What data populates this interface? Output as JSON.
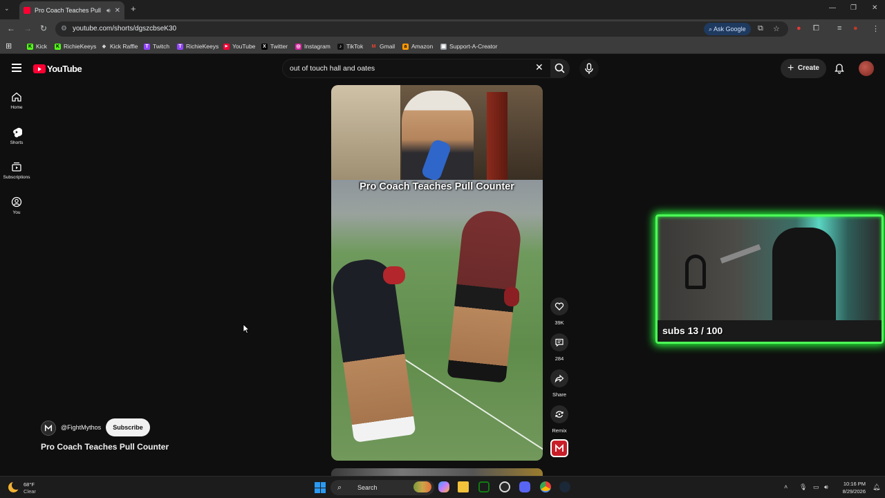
{
  "browser": {
    "tab_title": "Pro Coach Teaches Pull Counter",
    "url": "youtube.com/shorts/dgszcbseK30",
    "ask_google_label": "Ask Google",
    "bookmarks": [
      {
        "label": "Kick",
        "color": "#53fc18",
        "icon": "K"
      },
      {
        "label": "RichieKeeys",
        "color": "#53fc18",
        "icon": "K"
      },
      {
        "label": "Kick Raffle",
        "color": "#d0d0d0",
        "icon": "◆"
      },
      {
        "label": "Twitch",
        "color": "#9146ff",
        "icon": "T"
      },
      {
        "label": "RichieKeeys",
        "color": "#9146ff",
        "icon": "T"
      },
      {
        "label": "YouTube",
        "color": "#ff0033",
        "icon": "▶"
      },
      {
        "label": "Twitter",
        "color": "#000000",
        "icon": "X"
      },
      {
        "label": "Instagram",
        "color": "#d6249f",
        "icon": "◎"
      },
      {
        "label": "TikTok",
        "color": "#111111",
        "icon": "♪"
      },
      {
        "label": "Gmail",
        "color": "#ea4335",
        "icon": "M"
      },
      {
        "label": "Amazon",
        "color": "#ff9900",
        "icon": "a"
      },
      {
        "label": "Support-A-Creator",
        "color": "#9aa0a6",
        "icon": "▣"
      }
    ]
  },
  "youtube": {
    "logo_text": "YouTube",
    "search_query": "out of touch hall and oates",
    "create_label": "Create",
    "rail": [
      {
        "label": "Home",
        "icon": "home-icon"
      },
      {
        "label": "Shorts",
        "icon": "shorts-icon"
      },
      {
        "label": "Subscriptions",
        "icon": "subscriptions-icon"
      },
      {
        "label": "You",
        "icon": "you-icon"
      }
    ]
  },
  "short": {
    "overlay_title": "Pro Coach Teaches Pull Counter",
    "title": "Pro Coach Teaches Pull Counter",
    "channel_handle": "@FightMythos",
    "subscribe_label": "Subscribe",
    "likes": "39K",
    "comments": "284",
    "share_label": "Share",
    "remix_label": "Remix"
  },
  "stream_overlay": {
    "subs_text": "subs 13 / 100",
    "accent_color": "#4dff58"
  },
  "taskbar": {
    "weather_temp": "68°F",
    "weather_condition": "Clear",
    "search_label": "Search",
    "time": "10:16 PM",
    "date": "8/29/2026"
  }
}
